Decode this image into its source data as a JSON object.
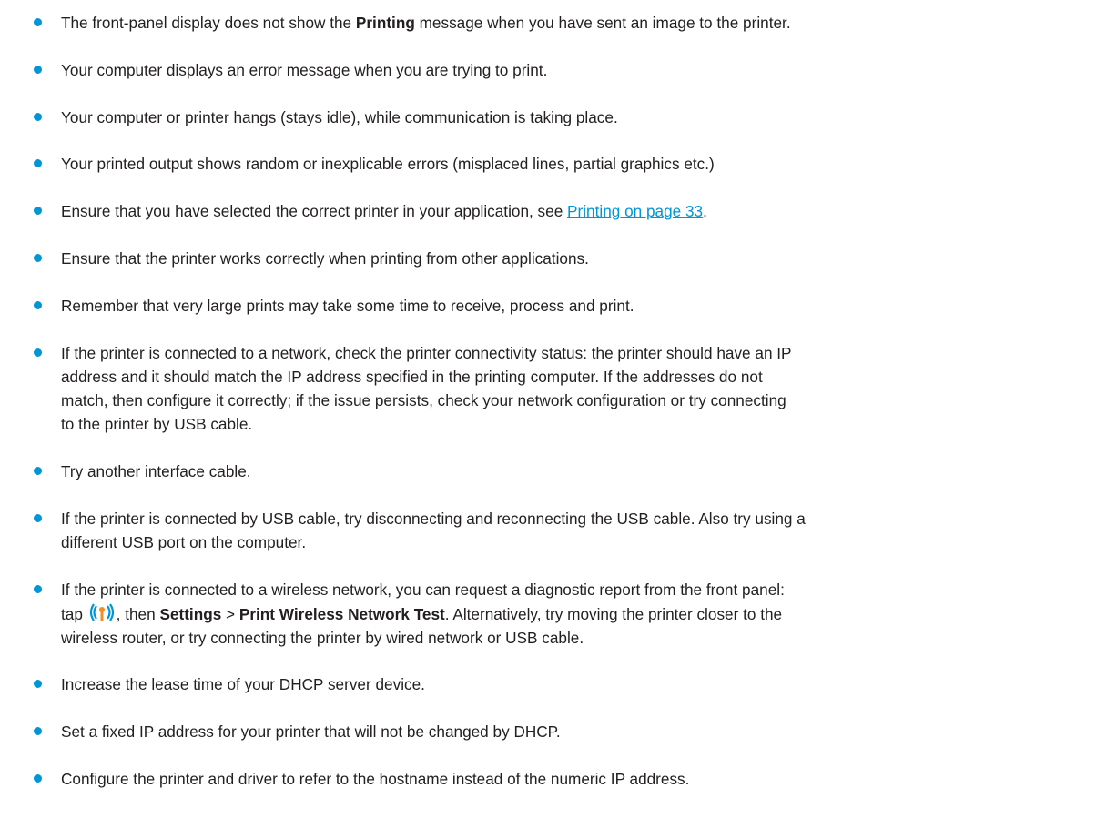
{
  "colors": {
    "bullet": "#0096d6",
    "link": "#0096d6",
    "text": "#231f20"
  },
  "items": [
    {
      "parts": [
        "The front-panel display does not show the ",
        "Printing",
        " message when you have sent an image to the printer."
      ]
    },
    {
      "text": "Your computer displays an error message when you are trying to print."
    },
    {
      "text": "Your computer or printer hangs (stays idle), while communication is taking place."
    },
    {
      "text": "Your printed output shows random or inexplicable errors (misplaced lines, partial graphics etc.)"
    },
    {
      "parts": [
        "Ensure that you have selected the correct printer in your application, see ",
        "Printing on page 33",
        "."
      ]
    },
    {
      "text": "Ensure that the printer works correctly when printing from other applications."
    },
    {
      "text": "Remember that very large prints may take some time to receive, process and print."
    },
    {
      "lines": [
        "If the printer is connected to a network, check the printer connectivity status: the printer should have an IP",
        "address and it should match the IP address specified in the printing computer. If the addresses do not",
        "match, then configure it correctly; if the issue persists, check your network configuration or try connecting",
        "to the printer by USB cable."
      ]
    },
    {
      "text": "Try another interface cable."
    },
    {
      "lines": [
        "If the printer is connected by USB cable, try disconnecting and reconnecting the USB cable. Also try using a",
        "different USB port on the computer."
      ]
    },
    {
      "line1": "If the printer is connected to a wireless network, you can request a diagnostic report from the front panel:",
      "parts": [
        "tap ",
        ", then ",
        "Settings",
        " > ",
        "Print Wireless Network Test",
        ". Alternatively, try moving the printer closer to the"
      ],
      "line3": "wireless router, or try connecting the printer by wired network or USB cable.",
      "icon": "wireless-icon"
    },
    {
      "text": "Increase the lease time of your DHCP server device."
    },
    {
      "text": "Set a fixed IP address for your printer that will not be changed by DHCP."
    },
    {
      "text": "Configure the printer and driver to refer to the hostname instead of the numeric IP address."
    }
  ]
}
